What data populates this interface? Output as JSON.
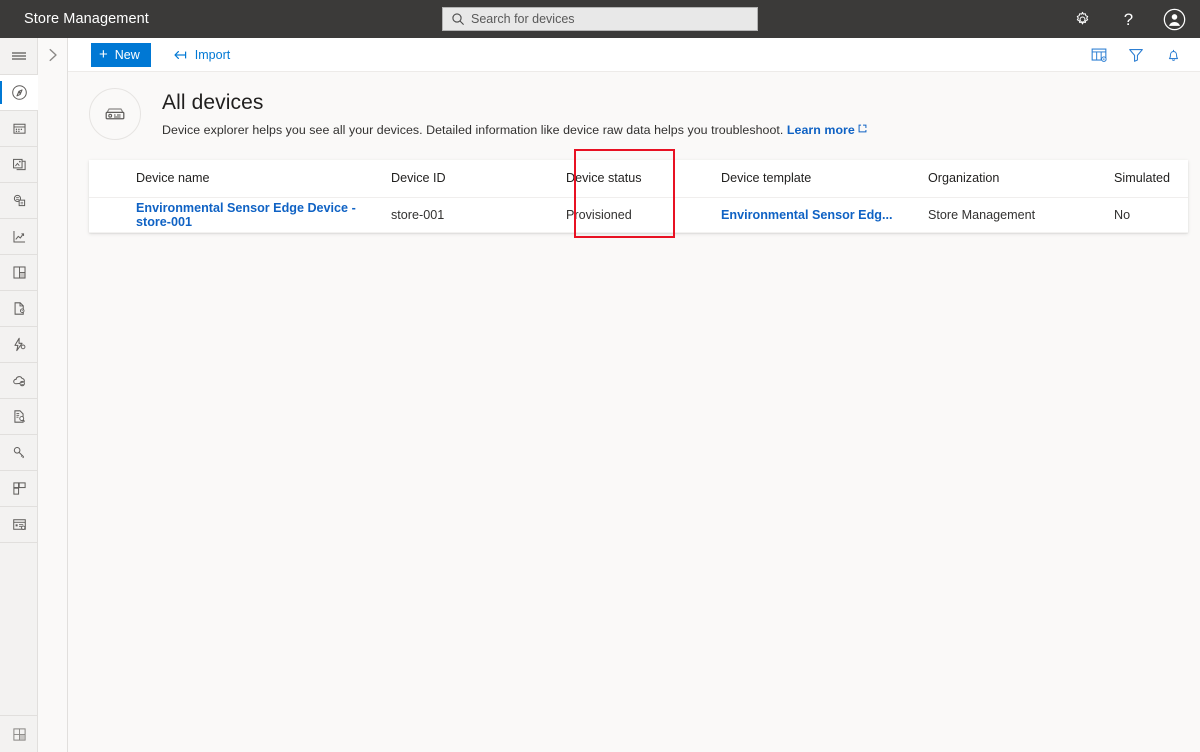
{
  "appbar": {
    "title": "Store Management",
    "search_placeholder": "Search for devices",
    "search_value": "",
    "icons": [
      {
        "name": "settings-gear-icon",
        "label": "Settings"
      },
      {
        "name": "help-question-icon",
        "label": "Help"
      },
      {
        "name": "account-avatar-icon",
        "label": "Account"
      }
    ]
  },
  "rail": {
    "hamburger_label": "Show navigation menu",
    "expand_label": "Expand navigation",
    "items": [
      {
        "name": "sidebar-item-devices",
        "icon": "devices-compass-icon",
        "active": true
      },
      {
        "name": "sidebar-item-device-groups",
        "icon": "device-groups-icon",
        "active": false
      },
      {
        "name": "sidebar-item-device-templates",
        "icon": "device-templates-icon",
        "active": false
      },
      {
        "name": "sidebar-item-data-export",
        "icon": "data-export-icon",
        "active": false
      },
      {
        "name": "sidebar-item-analytics",
        "icon": "analytics-chart-icon",
        "active": false
      },
      {
        "name": "sidebar-item-dashboards",
        "icon": "dashboard-grid-icon",
        "active": false
      },
      {
        "name": "sidebar-item-file-upload",
        "icon": "file-settings-icon",
        "active": false
      },
      {
        "name": "sidebar-item-rules",
        "icon": "rules-lightning-icon",
        "active": false
      },
      {
        "name": "sidebar-item-cloud-sync",
        "icon": "cloud-sync-icon",
        "active": false
      },
      {
        "name": "sidebar-item-jobs",
        "icon": "document-search-icon",
        "active": false
      },
      {
        "name": "sidebar-item-permissions",
        "icon": "key-icon",
        "active": false
      },
      {
        "name": "sidebar-item-app-templates",
        "icon": "layout-blocks-icon",
        "active": false
      },
      {
        "name": "sidebar-item-administration",
        "icon": "admin-panel-icon",
        "active": false
      }
    ],
    "bottom_item": {
      "name": "sidebar-item-app-switcher",
      "icon": "grid-apps-icon"
    }
  },
  "commandbar": {
    "new_label": "New",
    "import_label": "Import",
    "right_icons": [
      {
        "name": "column-options-icon",
        "label": "Column options"
      },
      {
        "name": "filter-funnel-icon",
        "label": "Filter"
      },
      {
        "name": "notification-bell-icon",
        "label": "Notifications"
      }
    ]
  },
  "page": {
    "icon": "device-explorer-icon",
    "title": "All devices",
    "subtitle": "Device explorer helps you see all your devices. Detailed information like device raw data helps you troubleshoot.",
    "learn_more": "Learn more"
  },
  "table": {
    "columns": [
      {
        "key": "device_name",
        "label": "Device name"
      },
      {
        "key": "device_id",
        "label": "Device ID"
      },
      {
        "key": "device_status",
        "label": "Device status"
      },
      {
        "key": "device_template",
        "label": "Device template"
      },
      {
        "key": "organization",
        "label": "Organization"
      },
      {
        "key": "simulated",
        "label": "Simulated"
      }
    ],
    "rows": [
      {
        "device_name": "Environmental Sensor Edge Device - store-001",
        "device_id": "store-001",
        "device_status": "Provisioned",
        "device_template": "Environmental Sensor Edg...",
        "organization": "Store Management",
        "simulated": "No"
      }
    ]
  },
  "annotation": {
    "highlight_color": "#e81123",
    "highlighted_column": "Device status"
  },
  "colors": {
    "accent": "#0078d4",
    "link": "#0f62c4",
    "appbar_bg": "#3b3a39",
    "content_bg": "#faf9f8",
    "highlight": "#e81123"
  }
}
